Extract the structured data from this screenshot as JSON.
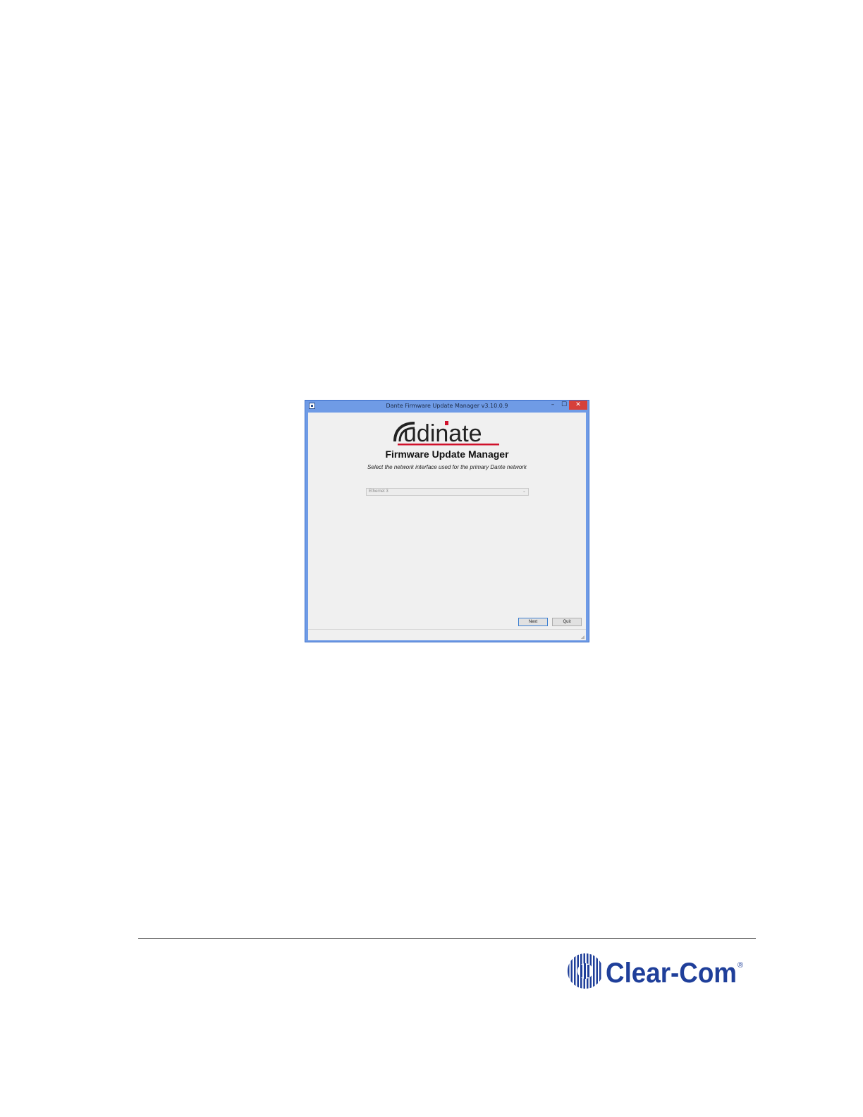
{
  "window": {
    "title": "Dante Firmware Update Manager v3.10.0.9",
    "minimize_glyph": "–",
    "maximize_glyph": "☐",
    "close_glyph": "✕"
  },
  "app": {
    "logo_text": "udinate",
    "logo_initial": "A",
    "product_name": "Firmware Update Manager",
    "instruction": "Select the network interface used for the primary Dante network",
    "interface_select": {
      "selected": "Ethernet 3",
      "chevron": "⌄"
    },
    "buttons": {
      "next": "Next",
      "quit": "Quit"
    }
  },
  "footer": {
    "brand": "Clear-Com",
    "registered_mark": "®"
  },
  "colors": {
    "titlebar": "#6f9be6",
    "close_button": "#d6403a",
    "audinate_red": "#d0112b",
    "clearcom_blue": "#1f3f9a"
  }
}
